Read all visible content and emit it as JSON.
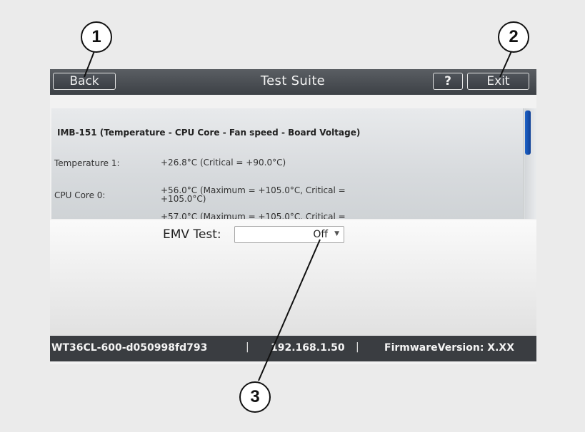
{
  "callouts": [
    "1",
    "2",
    "3"
  ],
  "header": {
    "back_label": "Back",
    "title": "Test Suite",
    "help_label": "?",
    "exit_label": "Exit"
  },
  "panel": {
    "heading": "IMB-151 (Temperature - CPU Core - Fan speed - Board Voltage)",
    "rows": [
      {
        "label": "Temperature 1:",
        "value": "+26.8°C (Critical = +90.0°C)"
      },
      {
        "label": "CPU Core 0:",
        "value": "+56.0°C (Maximum = +105.0°C, Critical = +105.0°C)"
      },
      {
        "label": "",
        "value": "+57.0°C (Maximum = +105.0°C, Critical ="
      }
    ]
  },
  "emv": {
    "label": "EMV Test:",
    "value": "Off"
  },
  "status": {
    "device_id": "WT36CL-600-d050998fd793",
    "separator": "|",
    "ip": "192.168.1.50",
    "firmware": "FirmwareVersion: X.XX"
  },
  "colors": {
    "topbar": "#464a4f",
    "statusbar": "#3a3d41",
    "scroll_thumb": "#1a56b8"
  }
}
